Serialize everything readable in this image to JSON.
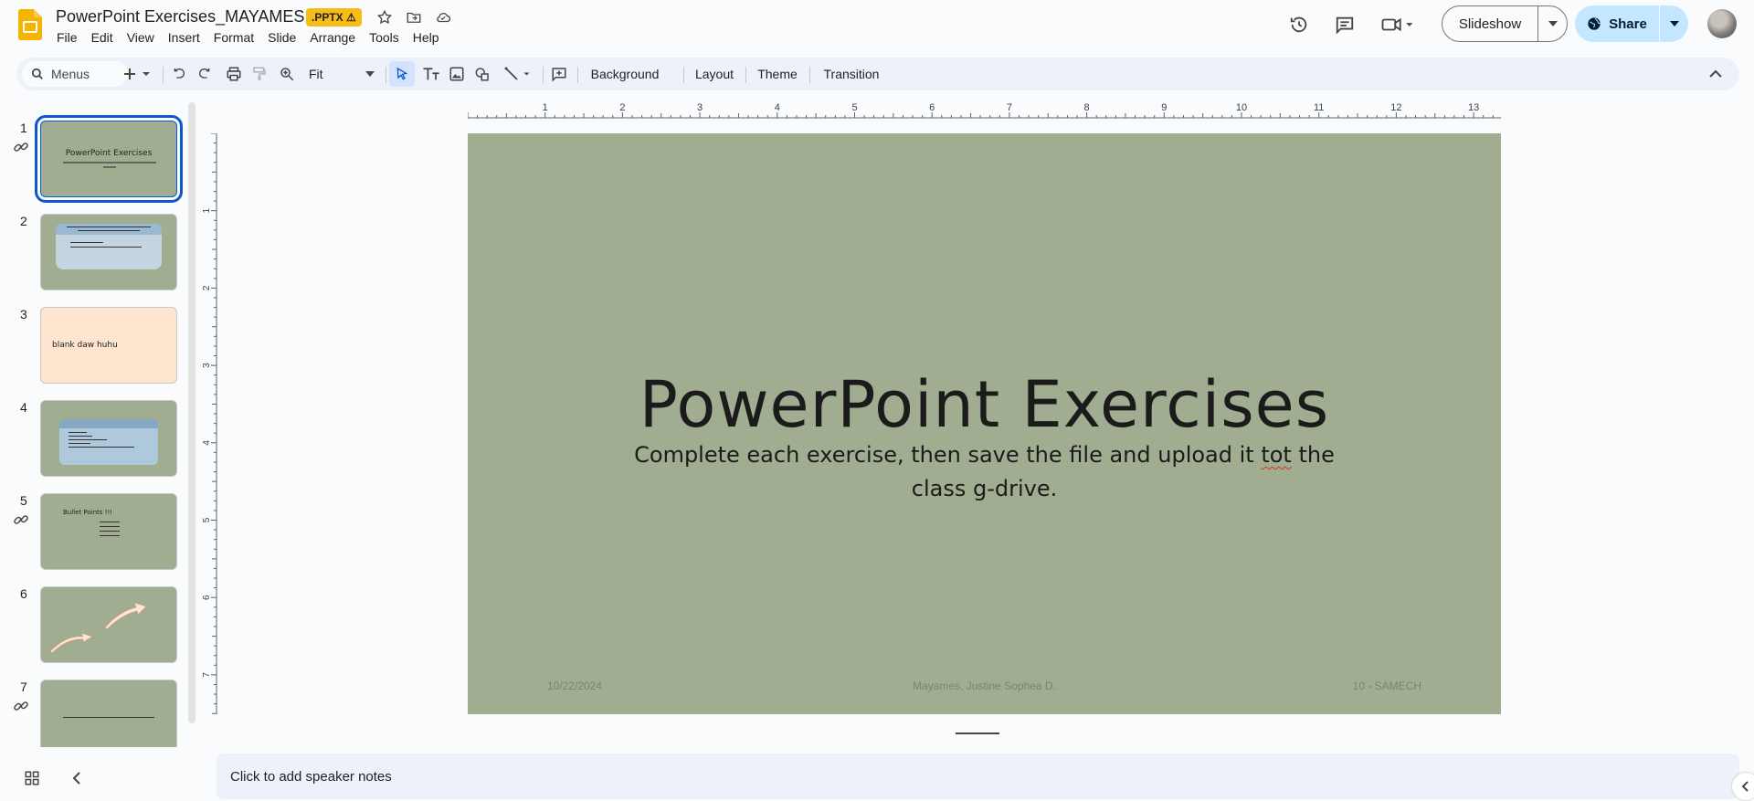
{
  "header": {
    "title": "PowerPoint Exercises_MAYAMES",
    "badge": ".PPTX",
    "menu": [
      "File",
      "Edit",
      "View",
      "Insert",
      "Format",
      "Slide",
      "Arrange",
      "Tools",
      "Help"
    ],
    "slideshow_label": "Slideshow",
    "share_label": "Share"
  },
  "toolbar": {
    "search_placeholder": "Menus",
    "zoom": "Fit",
    "background_label": "Background",
    "layout_label": "Layout",
    "theme_label": "Theme",
    "transition_label": "Transition"
  },
  "filmstrip": {
    "slides": [
      {
        "number": "1",
        "title": "PowerPoint Exercises"
      },
      {
        "number": "2"
      },
      {
        "number": "3",
        "text": "blank daw huhu"
      },
      {
        "number": "4"
      },
      {
        "number": "5",
        "text": "Bullet Points !!!"
      },
      {
        "number": "6"
      },
      {
        "number": "7"
      }
    ]
  },
  "rulers": {
    "horizontal": [
      "1",
      "2",
      "3",
      "4",
      "5",
      "6",
      "7",
      "8",
      "9",
      "10",
      "11",
      "12",
      "13"
    ],
    "vertical": [
      "1",
      "2",
      "3",
      "4",
      "5",
      "6",
      "7"
    ]
  },
  "slide": {
    "title": "PowerPoint Exercises",
    "subtitle_before": "Complete each exercise, then save the file and upload it ",
    "subtitle_misspelled": "tot",
    "subtitle_after": " the class g-drive.",
    "footer_date": "10/22/2024",
    "footer_name": "Mayames, Justine Sophea D.",
    "footer_section": "10 - SAMECH",
    "background_color": "#a0ad90"
  },
  "notes": {
    "placeholder": "Click to add speaker notes"
  },
  "colors": {
    "accent": "#0b57d0",
    "share_bg": "#c2e7ff",
    "badge": "#f7bd16"
  }
}
